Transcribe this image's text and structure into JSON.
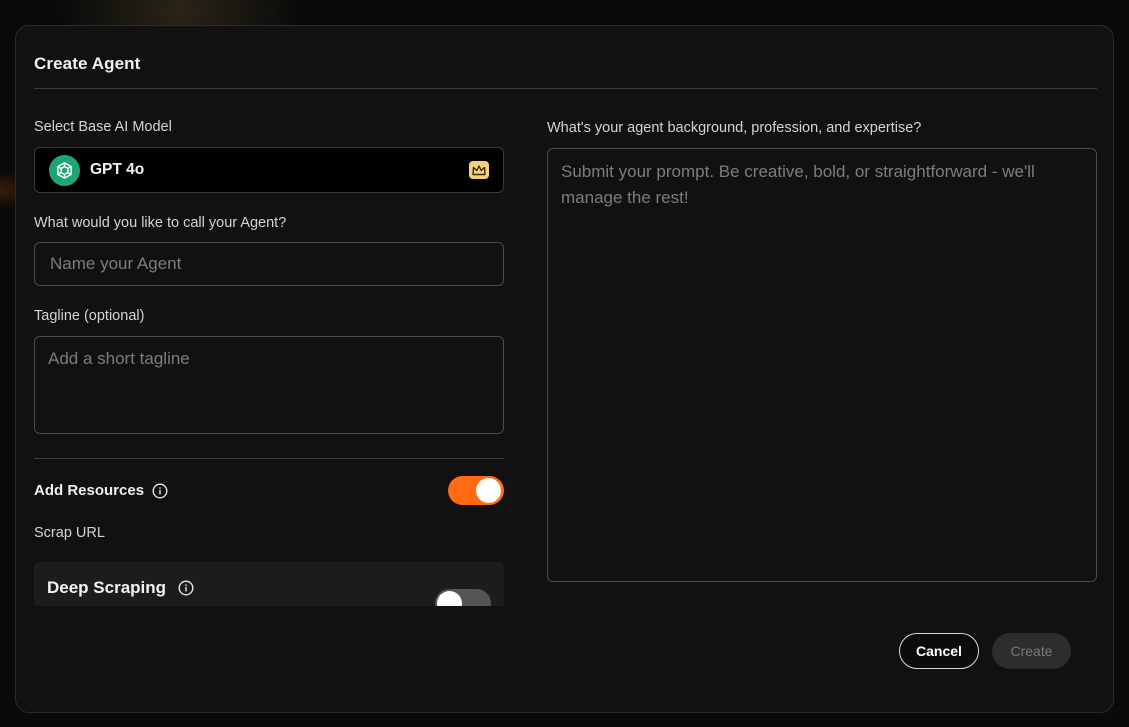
{
  "modal": {
    "title": "Create Agent"
  },
  "model": {
    "label": "Select Base AI Model",
    "selected": "GPT 4o"
  },
  "name_field": {
    "label": "What would you like to call your Agent?",
    "placeholder": "Name your Agent",
    "value": ""
  },
  "tagline_field": {
    "label": "Tagline (optional)",
    "placeholder": "Add a short tagline",
    "value": ""
  },
  "resources": {
    "label": "Add Resources",
    "enabled": true,
    "scrap_url_label": "Scrap URL",
    "deep_scraping_label": "Deep Scraping",
    "deep_scraping_enabled": false
  },
  "prompt_field": {
    "label": "What's your agent background, profession, and expertise?",
    "placeholder": "Submit your prompt. Be creative, bold, or straightforward - we'll manage the rest!",
    "value": ""
  },
  "actions": {
    "cancel_label": "Cancel",
    "create_label": "Create"
  },
  "colors": {
    "accent": "#ff6a13",
    "model_logo": "#21a37a",
    "premium_badge": "#f4d27a"
  },
  "icons": {
    "model_logo": "openai-logo-icon",
    "premium": "crown-icon",
    "info": "info-icon"
  }
}
